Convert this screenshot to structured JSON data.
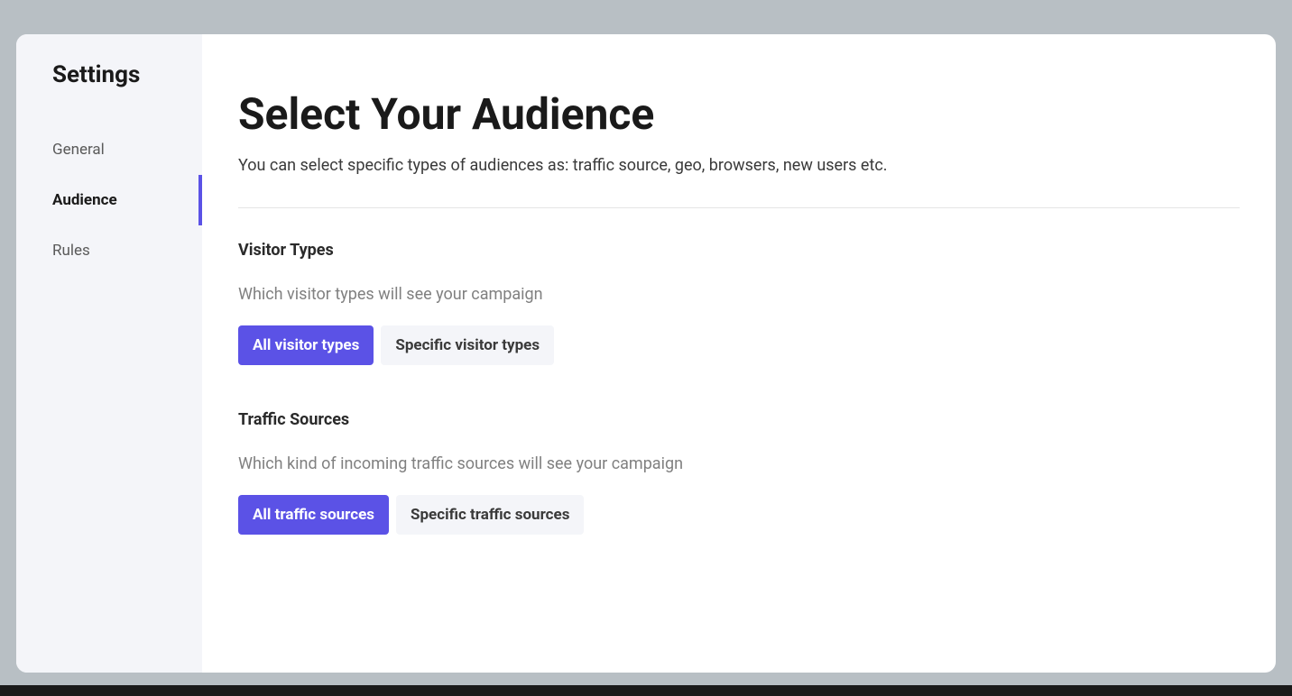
{
  "sidebar": {
    "title": "Settings",
    "items": [
      {
        "label": "General",
        "active": false
      },
      {
        "label": "Audience",
        "active": true
      },
      {
        "label": "Rules",
        "active": false
      }
    ]
  },
  "main": {
    "title": "Select Your Audience",
    "subtitle": "You can select specific types of audiences as: traffic source, geo, browsers, new users etc.",
    "sections": [
      {
        "title": "Visitor Types",
        "description": "Which visitor types will see your campaign",
        "options": [
          {
            "label": "All visitor types",
            "active": true
          },
          {
            "label": "Specific visitor types",
            "active": false
          }
        ]
      },
      {
        "title": "Traffic Sources",
        "description": "Which kind of incoming traffic sources will see your campaign",
        "options": [
          {
            "label": "All traffic sources",
            "active": true
          },
          {
            "label": "Specific traffic sources",
            "active": false
          }
        ]
      }
    ]
  }
}
